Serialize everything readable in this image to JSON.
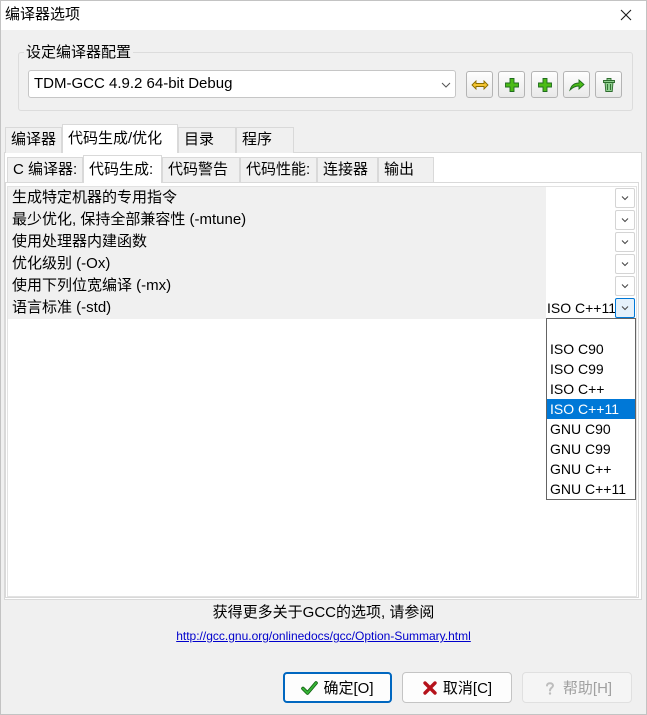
{
  "window": {
    "title": "编译器选项",
    "close_icon": "close-icon"
  },
  "compiler_set": {
    "group_label": "设定编译器配置",
    "selected": "TDM-GCC 4.9.2 64-bit Debug",
    "tool_buttons": [
      {
        "icon": "double-arrow-icon"
      },
      {
        "icon": "plus-icon"
      },
      {
        "icon": "plus-icon"
      },
      {
        "icon": "curved-arrow-icon"
      },
      {
        "icon": "trash-icon"
      }
    ]
  },
  "outer_tabs": [
    {
      "label": "编译器",
      "selected": false
    },
    {
      "label": "代码生成/优化",
      "selected": true
    },
    {
      "label": "目录",
      "selected": false
    },
    {
      "label": "程序",
      "selected": false
    }
  ],
  "inner_tabs": [
    {
      "label": "C 编译器:",
      "selected": false
    },
    {
      "label": "代码生成:",
      "selected": true
    },
    {
      "label": "代码警告",
      "selected": false
    },
    {
      "label": "代码性能:",
      "selected": false
    },
    {
      "label": "连接器",
      "selected": false
    },
    {
      "label": "输出",
      "selected": false
    }
  ],
  "properties": [
    {
      "label": "生成特定机器的专用指令"
    },
    {
      "label": "最少优化, 保持全部兼容性 (-mtune)"
    },
    {
      "label": "使用处理器内建函数"
    },
    {
      "label": "优化级别 (-Ox)"
    },
    {
      "label": "使用下列位宽编译 (-mx)"
    },
    {
      "label": "语言标准 (-std)",
      "value": "ISO C++11",
      "dropdown_open": true
    }
  ],
  "std_dropdown": {
    "options": [
      {
        "label": ""
      },
      {
        "label": "ISO C90"
      },
      {
        "label": "ISO C99"
      },
      {
        "label": "ISO C++"
      },
      {
        "label": "ISO C++11",
        "selected": true
      },
      {
        "label": "GNU C90"
      },
      {
        "label": "GNU C99"
      },
      {
        "label": "GNU C++"
      },
      {
        "label": "GNU C++11"
      }
    ]
  },
  "info": {
    "text": "获得更多关于GCC的选项, 请参阅",
    "link": "http://gcc.gnu.org/onlinedocs/gcc/Option-Summary.html"
  },
  "buttons": {
    "ok": {
      "label": "确定[O]",
      "icon": "check-icon",
      "focused": true,
      "disabled": false
    },
    "cancel": {
      "label": "取消[C]",
      "icon": "cross-icon",
      "focused": false,
      "disabled": false
    },
    "help": {
      "label": "帮助[H]",
      "icon": "question-icon",
      "focused": false,
      "disabled": true
    }
  },
  "colors": {
    "accent": "#0078d7",
    "focus_border": "#0067c0",
    "link": "#0000cc",
    "disabled_text": "#a0a0a0"
  }
}
